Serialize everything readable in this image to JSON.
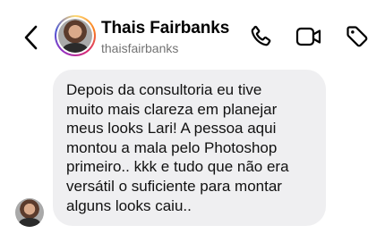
{
  "header": {
    "name": "Thais Fairbanks",
    "handle": "thaisfairbanks",
    "icons": [
      "back-icon",
      "phone-icon",
      "video-call-icon",
      "tag-icon"
    ]
  },
  "message": {
    "lines": [
      "Depois da consultoria eu tive",
      "muito mais clareza em planejar",
      "meus looks Lari! A pessoa aqui",
      "montou a mala pelo Photoshop",
      "primeiro.. kkk e tudo que não era",
      "versátil o suficiente para montar",
      "alguns looks caiu.."
    ]
  },
  "colors": {
    "bubble": "#efeff1",
    "handle": "#737373",
    "text": "#111111"
  }
}
